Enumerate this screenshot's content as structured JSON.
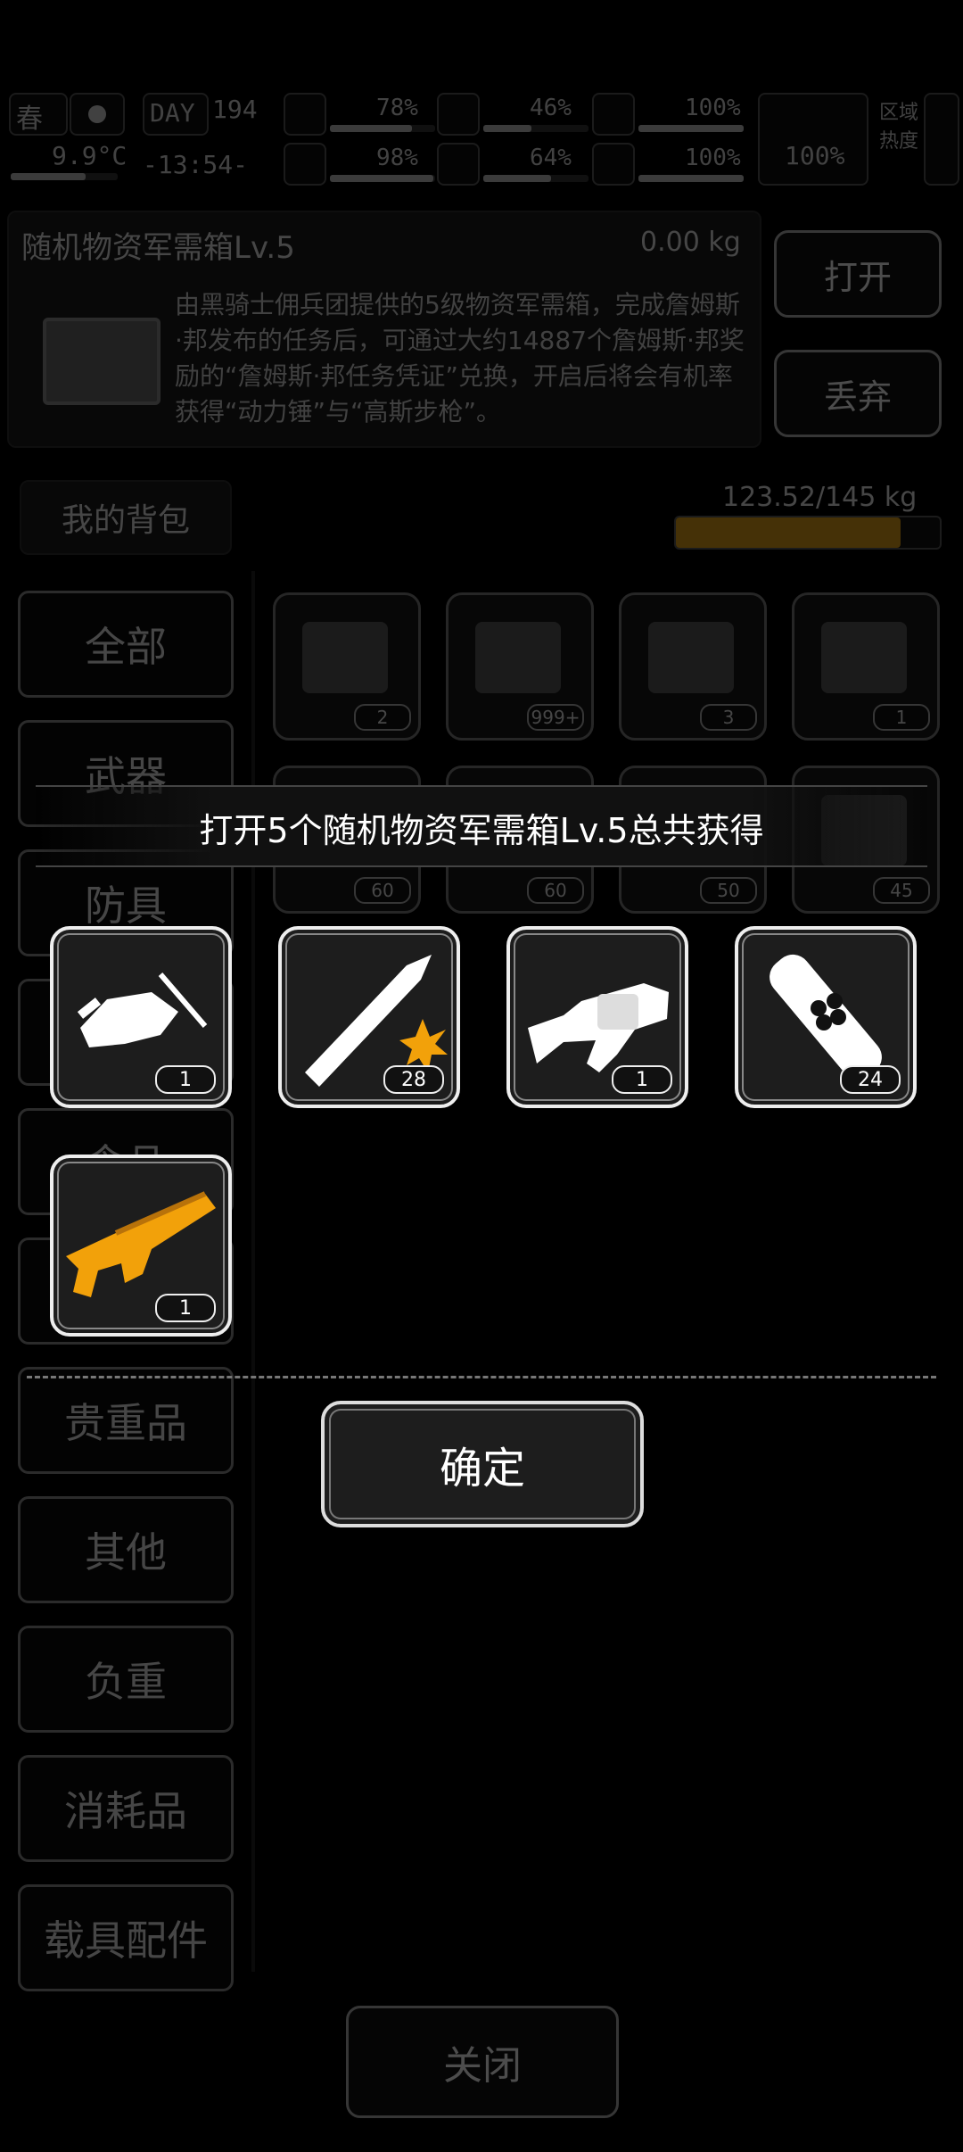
{
  "status": {
    "season": "春",
    "day_label": "DAY",
    "day_number": "194",
    "temperature": "9.9°C",
    "time": "-13:54-",
    "stats": [
      {
        "icon": "medkit-icon",
        "value": "78%",
        "level": 0.78
      },
      {
        "icon": "stomach-icon",
        "value": "46%",
        "level": 0.46
      },
      {
        "icon": "canteen-icon",
        "value": "100%",
        "level": 1.0
      },
      {
        "icon": "brain-icon",
        "value": "98%",
        "level": 0.98
      },
      {
        "icon": "water-drop-icon",
        "value": "64%",
        "level": 0.64
      },
      {
        "icon": "heart-icon",
        "value": "100%",
        "level": 1.0
      }
    ],
    "battery_value": "100%",
    "zone_heat_label": "区域\n热度"
  },
  "item": {
    "name": "随机物资军需箱Lv.5",
    "weight": "0.00 kg",
    "description": "由黑骑士佣兵团提供的5级物资军需箱，完成詹姆斯·邦发布的任务后，可通过大约14887个詹姆斯·邦奖励的“詹姆斯·邦任务凭证”兑换，开启后将会有机率获得“动力锤”与“高斯步枪”。",
    "open_label": "打开",
    "discard_label": "丢弃"
  },
  "backpack": {
    "tab_label": "我的背包",
    "capacity": "123.52/145 kg",
    "capacity_fraction": 0.85
  },
  "categories": [
    "全部",
    "武器",
    "防具",
    "",
    "食品",
    "",
    "贵重品",
    "其他",
    "负重",
    "消耗品",
    "载具配件"
  ],
  "inventory": [
    {
      "icon": "crystal-icon",
      "count": "2"
    },
    {
      "icon": "bitcoin-coin-icon",
      "count": "999+"
    },
    {
      "icon": "crate-icon",
      "count": "3"
    },
    {
      "icon": "crate-icon",
      "count": "1"
    },
    {
      "icon": "crate-icon",
      "count": "60"
    },
    {
      "icon": "crate-icon",
      "count": "60"
    },
    {
      "icon": "crate-icon",
      "count": "50"
    },
    {
      "icon": "crate-icon",
      "count": "45"
    }
  ],
  "modal": {
    "title": "打开5个随机物资军需箱Lv.5总共获得",
    "rewards": [
      {
        "icon": "power-hammer-icon",
        "count": "1"
      },
      {
        "icon": "rifle-bullet-icon",
        "count": "28"
      },
      {
        "icon": "grenade-launcher-icon",
        "count": "1"
      },
      {
        "icon": "grenade-round-icon",
        "count": "24"
      },
      {
        "icon": "gauss-rifle-icon",
        "count": "1"
      }
    ],
    "confirm_label": "确定"
  },
  "footer": {
    "close_label": "关闭"
  }
}
